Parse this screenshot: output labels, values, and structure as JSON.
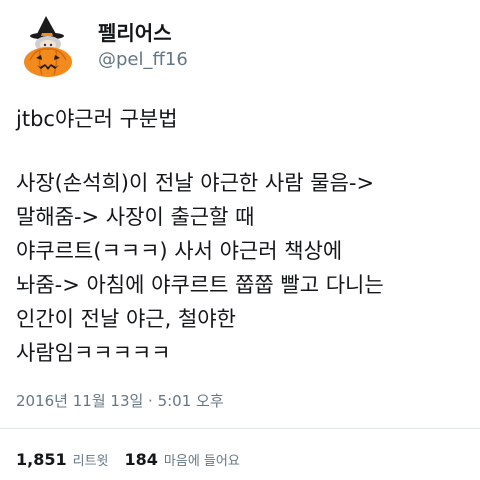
{
  "author": {
    "display_name": "펠리어스",
    "handle": "@pel_ff16",
    "avatar_icon": "pumpkin-avatar-icon"
  },
  "tweet": {
    "title_line": "jtbc야근러 구분법",
    "lines": [
      "사장(손석희)이 전날 야근한 사람 물음->",
      "말해줌-> 사장이 출근할 때",
      "야쿠르트(ㅋㅋㅋ) 사서 야근러 책상에",
      "놔줌-> 아침에 야쿠르트 쭙쭙 빨고 다니는",
      "인간이 전날 야근, 철야한",
      "사람임ㅋㅋㅋㅋㅋ"
    ]
  },
  "timestamp": "2016년 11월 13일 · 5:01 오후",
  "stats": {
    "retweets_count": "1,851",
    "retweets_label": "리트윗",
    "likes_count": "184",
    "likes_label": "마음에 들어요"
  },
  "colors": {
    "text": "#14171a",
    "muted": "#657786",
    "divider": "#e1e8ed",
    "pumpkin": "#f28a1e"
  }
}
